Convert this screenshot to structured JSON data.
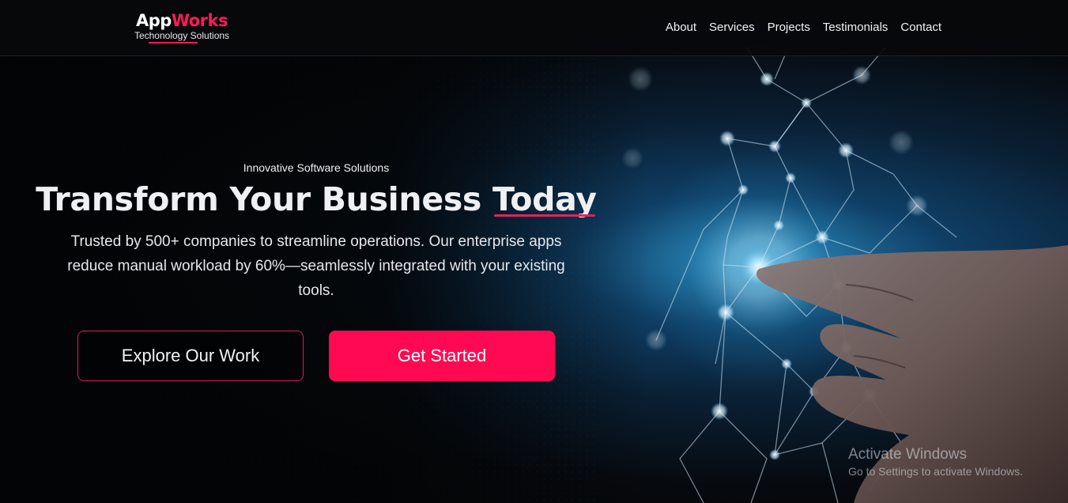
{
  "header": {
    "logo": {
      "app": "App",
      "works": "Works",
      "subtitle": "Techonology Solutions"
    },
    "nav": [
      {
        "label": "About"
      },
      {
        "label": "Services"
      },
      {
        "label": "Projects"
      },
      {
        "label": "Testimonials"
      },
      {
        "label": "Contact"
      }
    ]
  },
  "hero": {
    "kicker": "Innovative Software Solutions",
    "headline_main": "Transform Your Business ",
    "headline_highlight": "Today",
    "description": "Trusted by 500+ companies to streamline operations. Our enterprise apps reduce manual workload by 60%—seamlessly integrated with your existing tools.",
    "buttons": {
      "secondary": "Explore Our Work",
      "primary": "Get Started"
    }
  },
  "watermark": {
    "title": "Activate Windows",
    "subtitle": "Go to Settings to activate Windows."
  },
  "colors": {
    "accent": "#ff0a52",
    "background": "#050608",
    "text": "#eef0f4"
  },
  "icons": [
    "network-graphic",
    "hand-image"
  ]
}
